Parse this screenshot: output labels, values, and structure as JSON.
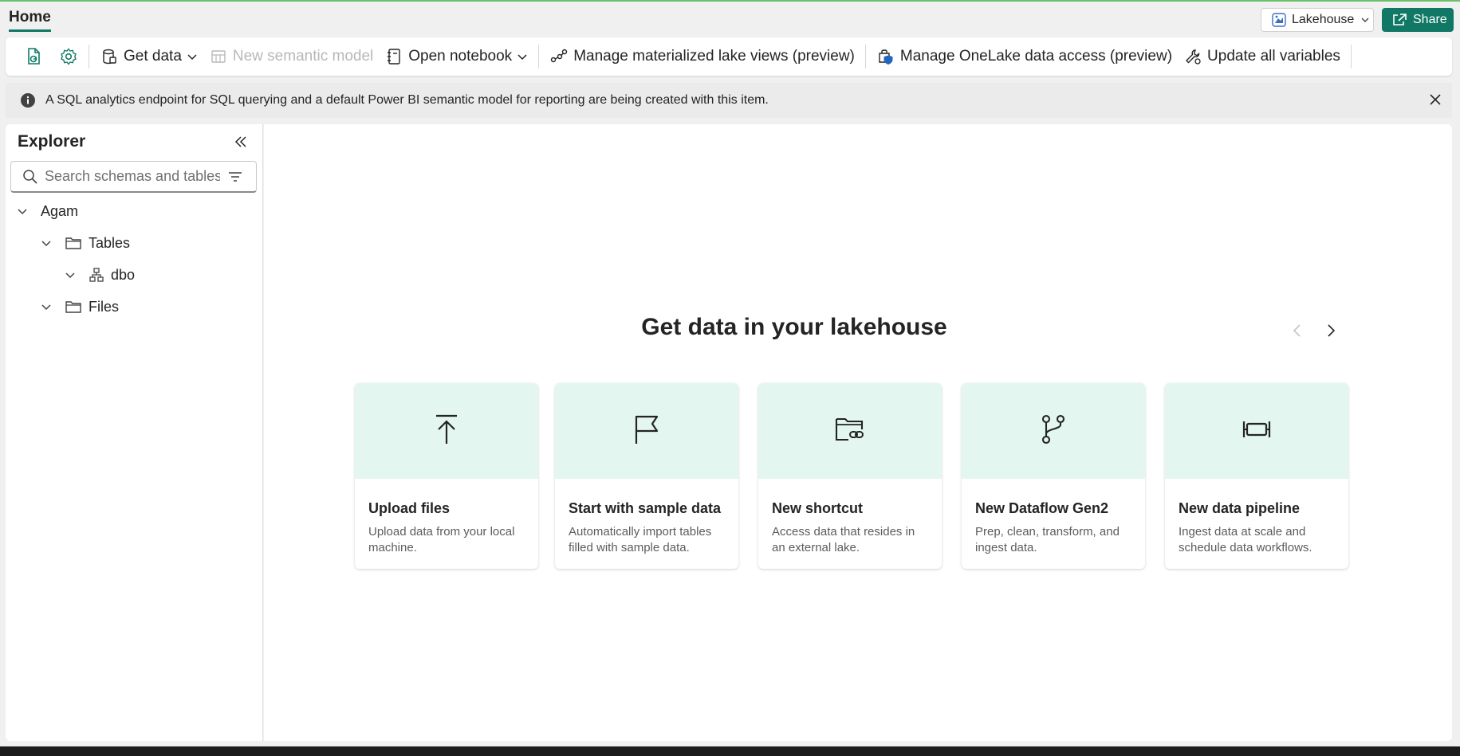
{
  "tabbar": {
    "home_tab": "Home",
    "lakehouse_button": "Lakehouse",
    "share_button": "Share"
  },
  "ribbon": {
    "get_data": "Get data",
    "new_semantic_model": "New semantic model",
    "open_notebook": "Open notebook",
    "manage_lake_views": "Manage materialized lake views (preview)",
    "manage_onelake": "Manage OneLake data access (preview)",
    "update_variables": "Update all variables"
  },
  "message": {
    "text": "A SQL analytics endpoint for SQL querying and a default Power BI semantic model for reporting are being created with this item."
  },
  "explorer": {
    "title": "Explorer",
    "search_placeholder": "Search schemas and tables",
    "tree": {
      "root": "Agam",
      "tables": "Tables",
      "schema": "dbo",
      "files": "Files"
    }
  },
  "main": {
    "title": "Get data in your lakehouse",
    "cards": [
      {
        "icon": "upload-icon",
        "title": "Upload files",
        "desc": "Upload data from your local machine."
      },
      {
        "icon": "flag-icon",
        "title": "Start with sample data",
        "desc": "Automatically import tables filled with sample data."
      },
      {
        "icon": "folder-link-icon",
        "title": "New shortcut",
        "desc": "Access data that resides in an external lake."
      },
      {
        "icon": "branch-icon",
        "title": "New Dataflow Gen2",
        "desc": "Prep, clean, transform, and ingest data."
      },
      {
        "icon": "pipeline-icon",
        "title": "New data pipeline",
        "desc": "Ingest data at scale and schedule data workflows."
      }
    ]
  },
  "colors": {
    "accent": "#117865",
    "card_header": "#e3f6ef",
    "disabled_text": "#b8b8b8"
  }
}
